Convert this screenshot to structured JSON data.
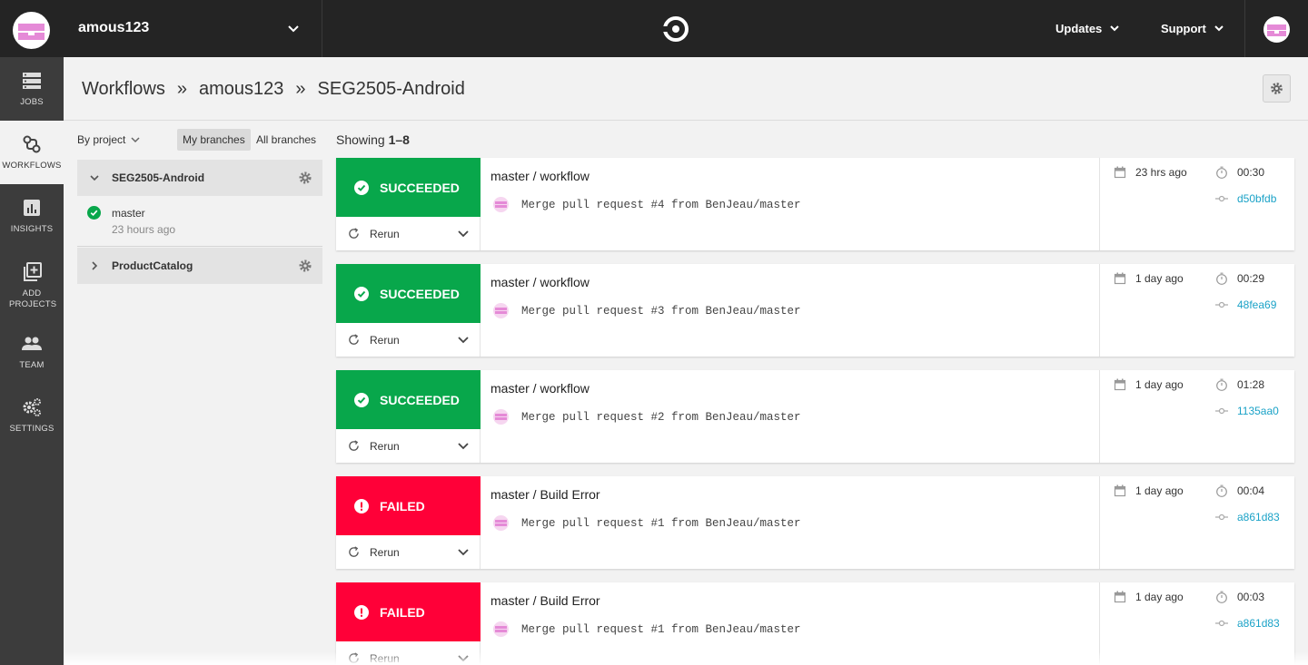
{
  "topbar": {
    "org_name": "amous123",
    "updates_label": "Updates",
    "support_label": "Support"
  },
  "sidebar": {
    "items": [
      {
        "label": "JOBS",
        "icon": "jobs-icon"
      },
      {
        "label": "WORKFLOWS",
        "icon": "workflows-icon"
      },
      {
        "label": "INSIGHTS",
        "icon": "insights-icon"
      },
      {
        "label": "ADD PROJECTS",
        "icon": "add-projects-icon"
      },
      {
        "label": "TEAM",
        "icon": "team-icon"
      },
      {
        "label": "SETTINGS",
        "icon": "settings-icon"
      }
    ]
  },
  "breadcrumb": [
    "Workflows",
    "amous123",
    "SEG2505-Android"
  ],
  "breadcrumb_sep": "»",
  "filter": {
    "by_project": "By project",
    "my_branches": "My branches",
    "all_branches": "All branches"
  },
  "projects": [
    {
      "name": "SEG2505-Android",
      "expanded": true,
      "branches": [
        {
          "name": "master",
          "time": "23 hours ago"
        }
      ]
    },
    {
      "name": "ProductCatalog",
      "expanded": false
    }
  ],
  "showing": {
    "prefix": "Showing ",
    "range": "1–8"
  },
  "colors": {
    "success": "#08a74b",
    "failed": "#ff0038",
    "sha": "#1aa2c7"
  },
  "workflows": [
    {
      "status": "SUCCEEDED",
      "title": "master / workflow",
      "commit": "Merge pull request #4 from BenJeau/master",
      "when": "23 hrs ago",
      "duration": "00:30",
      "sha": "d50bfdb",
      "rerun": "Rerun"
    },
    {
      "status": "SUCCEEDED",
      "title": "master / workflow",
      "commit": "Merge pull request #3 from BenJeau/master",
      "when": "1 day ago",
      "duration": "00:29",
      "sha": "48fea69",
      "rerun": "Rerun"
    },
    {
      "status": "SUCCEEDED",
      "title": "master / workflow",
      "commit": "Merge pull request #2 from BenJeau/master",
      "when": "1 day ago",
      "duration": "01:28",
      "sha": "1135aa0",
      "rerun": "Rerun"
    },
    {
      "status": "FAILED",
      "title": "master / Build Error",
      "commit": "Merge pull request #1 from BenJeau/master",
      "when": "1 day ago",
      "duration": "00:04",
      "sha": "a861d83",
      "rerun": "Rerun"
    },
    {
      "status": "FAILED",
      "title": "master / Build Error",
      "commit": "Merge pull request #1 from BenJeau/master",
      "when": "1 day ago",
      "duration": "00:03",
      "sha": "a861d83",
      "rerun": "Rerun"
    }
  ]
}
